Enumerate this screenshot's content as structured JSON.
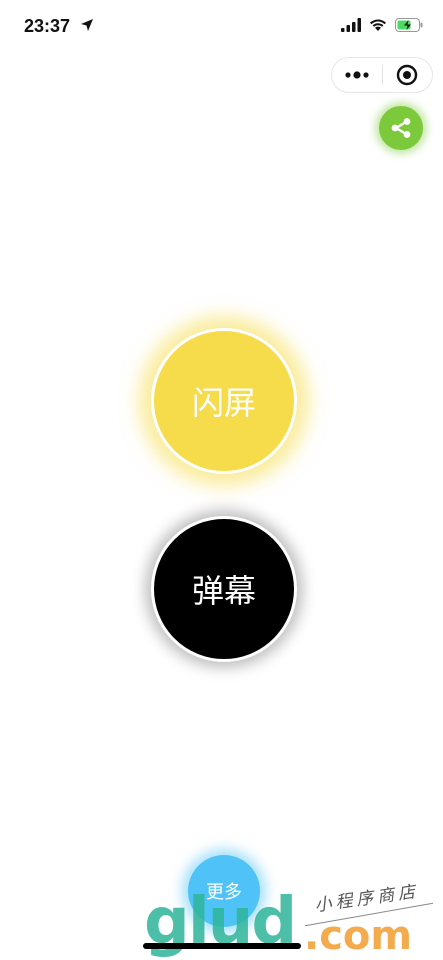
{
  "status_bar": {
    "time": "23:37",
    "location_icon": "location-arrow-icon",
    "signal_icon": "cellular-signal-icon",
    "wifi_icon": "wifi-icon",
    "battery_icon": "battery-charging-icon"
  },
  "capsule": {
    "more_icon": "more-dots-icon",
    "close_icon": "target-close-icon"
  },
  "share": {
    "icon": "share-icon",
    "color": "#7cc93b"
  },
  "buttons": {
    "flash_label": "闪屏",
    "flash_color": "#f6dc4b",
    "danmaku_label": "弹幕",
    "danmaku_color": "#000000",
    "more_label": "更多",
    "more_color": "#4fc3f7"
  },
  "watermark": {
    "logo": "glud",
    "domain": ".com",
    "tagline": "小程序商店"
  }
}
